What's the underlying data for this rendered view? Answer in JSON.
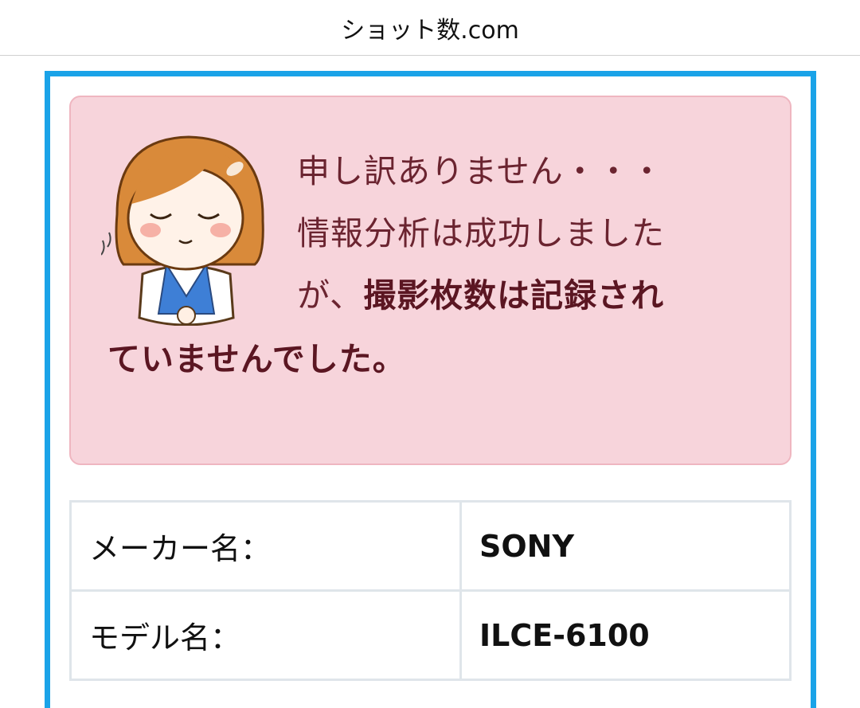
{
  "header": {
    "title": "ショット数.com"
  },
  "alert": {
    "line1": "申し訳ありません・・・",
    "line2": "情報分析は成功しました",
    "line3_prefix": "が、",
    "line3_bold": "撮影枚数は記録され",
    "line4_bold": "ていませんでした。",
    "avatar_icon": "bowing-woman-icon",
    "background": "#f7d4db"
  },
  "info_table": {
    "rows": [
      {
        "label": "メーカー名：",
        "value": "SONY"
      },
      {
        "label": "モデル名：",
        "value": "ILCE-6100"
      }
    ]
  },
  "colors": {
    "frame": "#1aa3e8"
  }
}
